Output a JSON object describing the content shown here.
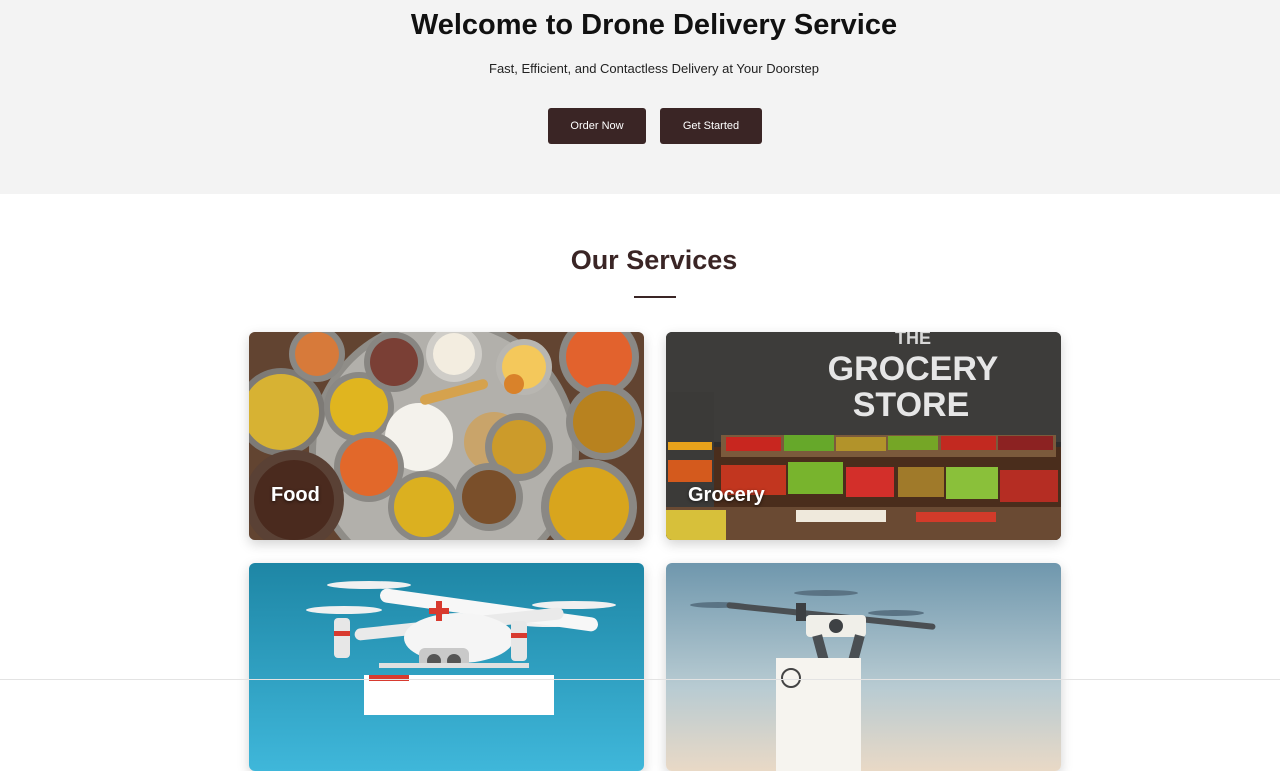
{
  "hero": {
    "title": "Welcome to Drone Delivery Service",
    "subtitle": "Fast, Efficient, and Contactless Delivery at Your Doorstep",
    "order_button": "Order Now",
    "start_button": "Get Started"
  },
  "services": {
    "title": "Our Services",
    "cards": [
      {
        "label": "Food",
        "image": "indian-thali-image"
      },
      {
        "label": "Grocery",
        "image": "grocery-store-image"
      },
      {
        "label": "",
        "image": "medical-drone-image"
      },
      {
        "label": "",
        "image": "package-drone-image"
      }
    ],
    "store_sign": "THE GROCERY STORE"
  },
  "colors": {
    "hero_bg": "#f3f3f3",
    "button_bg": "#3a2525",
    "heading_brown": "#3a2525"
  }
}
